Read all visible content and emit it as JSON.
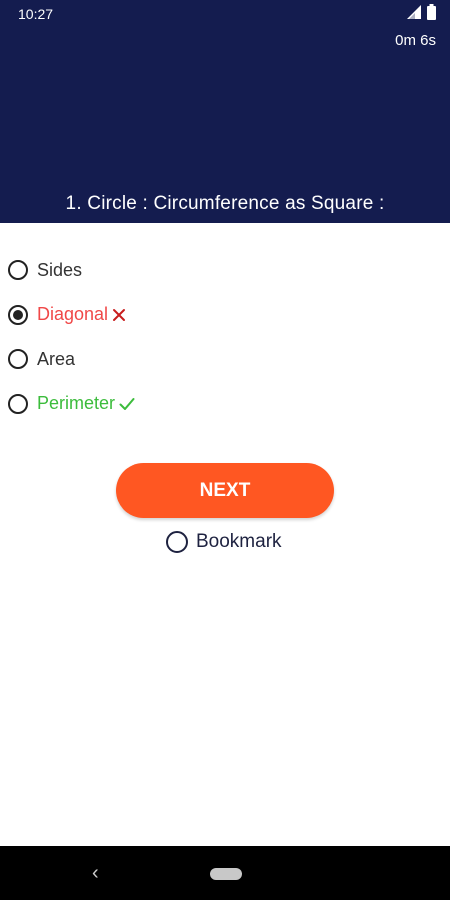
{
  "status_bar": {
    "time": "10:27",
    "icons": [
      "signal-icon",
      "battery-icon"
    ]
  },
  "timer": "0m 6s",
  "question": "1. Circle : Circumference as Square :",
  "options": [
    {
      "label": "Sides",
      "selected": false,
      "state": "neutral"
    },
    {
      "label": "Diagonal",
      "selected": true,
      "state": "wrong",
      "mark_icon": "cross-icon"
    },
    {
      "label": "Area",
      "selected": false,
      "state": "neutral"
    },
    {
      "label": "Perimeter",
      "selected": false,
      "state": "correct",
      "mark_icon": "check-icon"
    }
  ],
  "next_button": "NEXT",
  "bookmark": {
    "label": "Bookmark",
    "checked": false
  },
  "nav_bar": {
    "icons": [
      "back-icon",
      "home-pill"
    ]
  },
  "colors": {
    "header_bg": "#141c4f",
    "next_button_bg": "#ff5722",
    "wrong": "#f04848",
    "correct": "#3cbc3c"
  }
}
